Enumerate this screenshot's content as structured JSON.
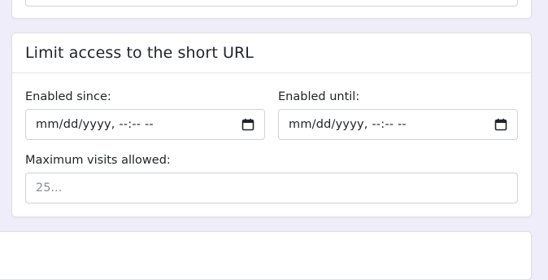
{
  "limit_access": {
    "title": "Limit access to the short URL",
    "enabled_since": {
      "label": "Enabled since:",
      "value": "mm/dd/yyyy, --:-- --"
    },
    "enabled_until": {
      "label": "Enabled until:",
      "value": "mm/dd/yyyy, --:-- --"
    },
    "max_visits": {
      "label": "Maximum visits allowed:",
      "placeholder": "25...",
      "value": ""
    }
  },
  "icons": {
    "calendar": "calendar-icon"
  },
  "colors": {
    "page_background": "#eeedf9",
    "card_background": "#ffffff",
    "input_border": "#ced4da"
  }
}
